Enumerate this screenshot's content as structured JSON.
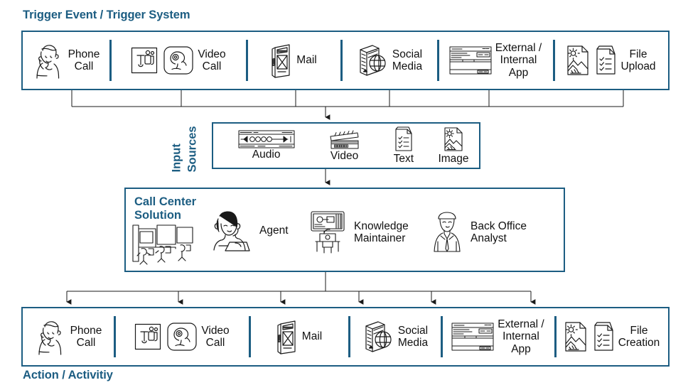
{
  "captions": {
    "trigger": "Trigger Event / Trigger System",
    "action": "Action / Activitiy",
    "input_sources_line1": "Input",
    "input_sources_line2": "Sources"
  },
  "colors": {
    "accent": "#1C5D82",
    "text": "#111111",
    "connector": "#1a1a1a",
    "background": "#ffffff"
  },
  "trigger_row": {
    "cells": [
      {
        "label": "Phone\nCall",
        "icons": [
          "headset-person-icon"
        ]
      },
      {
        "label": "Video\nCall",
        "icons": [
          "teams-app-icon",
          "webcam-icon"
        ]
      },
      {
        "label": "Mail",
        "icons": [
          "mailbox-icon"
        ]
      },
      {
        "label": "Social\nMedia",
        "icons": [
          "server-globe-icon"
        ]
      },
      {
        "label": "External /\nInternal\nApp",
        "icons": [
          "app-window-icon"
        ]
      },
      {
        "label": "File\nUpload",
        "icons": [
          "jpg-image-file-icon",
          "checklist-document-icon"
        ]
      }
    ]
  },
  "input_sources": {
    "items": [
      {
        "label": "Audio",
        "icon": "audio-waveform-icon"
      },
      {
        "label": "Video",
        "icon": "clapperboard-icon"
      },
      {
        "label": "Text",
        "icon": "checklist-document-icon"
      },
      {
        "label": "Image",
        "icon": "jpg-image-file-icon"
      }
    ]
  },
  "solution": {
    "title": "Call Center\nSolution",
    "hero_icon": "call-center-desks-icon",
    "roles": [
      {
        "label": "Agent",
        "icon": "agent-headset-icon"
      },
      {
        "label": "Knowledge\nMaintainer",
        "icon": "knowledge-worker-monitor-icon"
      },
      {
        "label": "Back Office\nAnalyst",
        "icon": "office-analyst-icon"
      }
    ]
  },
  "action_row": {
    "cells": [
      {
        "label": "Phone\nCall",
        "icons": [
          "headset-person-icon"
        ]
      },
      {
        "label": "Video\nCall",
        "icons": [
          "teams-app-icon",
          "webcam-icon"
        ]
      },
      {
        "label": "Mail",
        "icons": [
          "mailbox-icon"
        ]
      },
      {
        "label": "Social\nMedia",
        "icons": [
          "server-globe-icon"
        ]
      },
      {
        "label": "External /\nInternal\nApp",
        "icons": [
          "app-window-icon"
        ]
      },
      {
        "label": "File\nCreation",
        "icons": [
          "jpg-image-file-icon",
          "checklist-document-icon"
        ]
      }
    ]
  }
}
